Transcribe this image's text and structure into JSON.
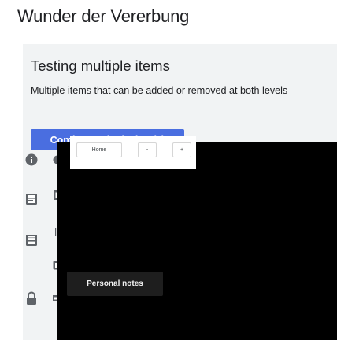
{
  "page": {
    "title": "Wunder der Vererbung"
  },
  "card": {
    "title": "Testing multiple items",
    "description": "Multiple items that can be added or removed at both levels",
    "submit_label": "Continue submission (1)"
  },
  "toolbar": {
    "icons": [
      "info-icon",
      "circle-icon",
      "bold-format-icon",
      "image-icon",
      "list-icon",
      "document-icon",
      "copy-icon",
      "lock-icon",
      "link-icon"
    ]
  },
  "preview": {
    "nav": {
      "home_label": "Home",
      "minus_label": "-",
      "plus_label": "+"
    },
    "notes_label": "Personal notes"
  },
  "colors": {
    "accent": "#4a6ee0",
    "card_bg": "#f1f3f4",
    "preview_bg": "#000000"
  }
}
